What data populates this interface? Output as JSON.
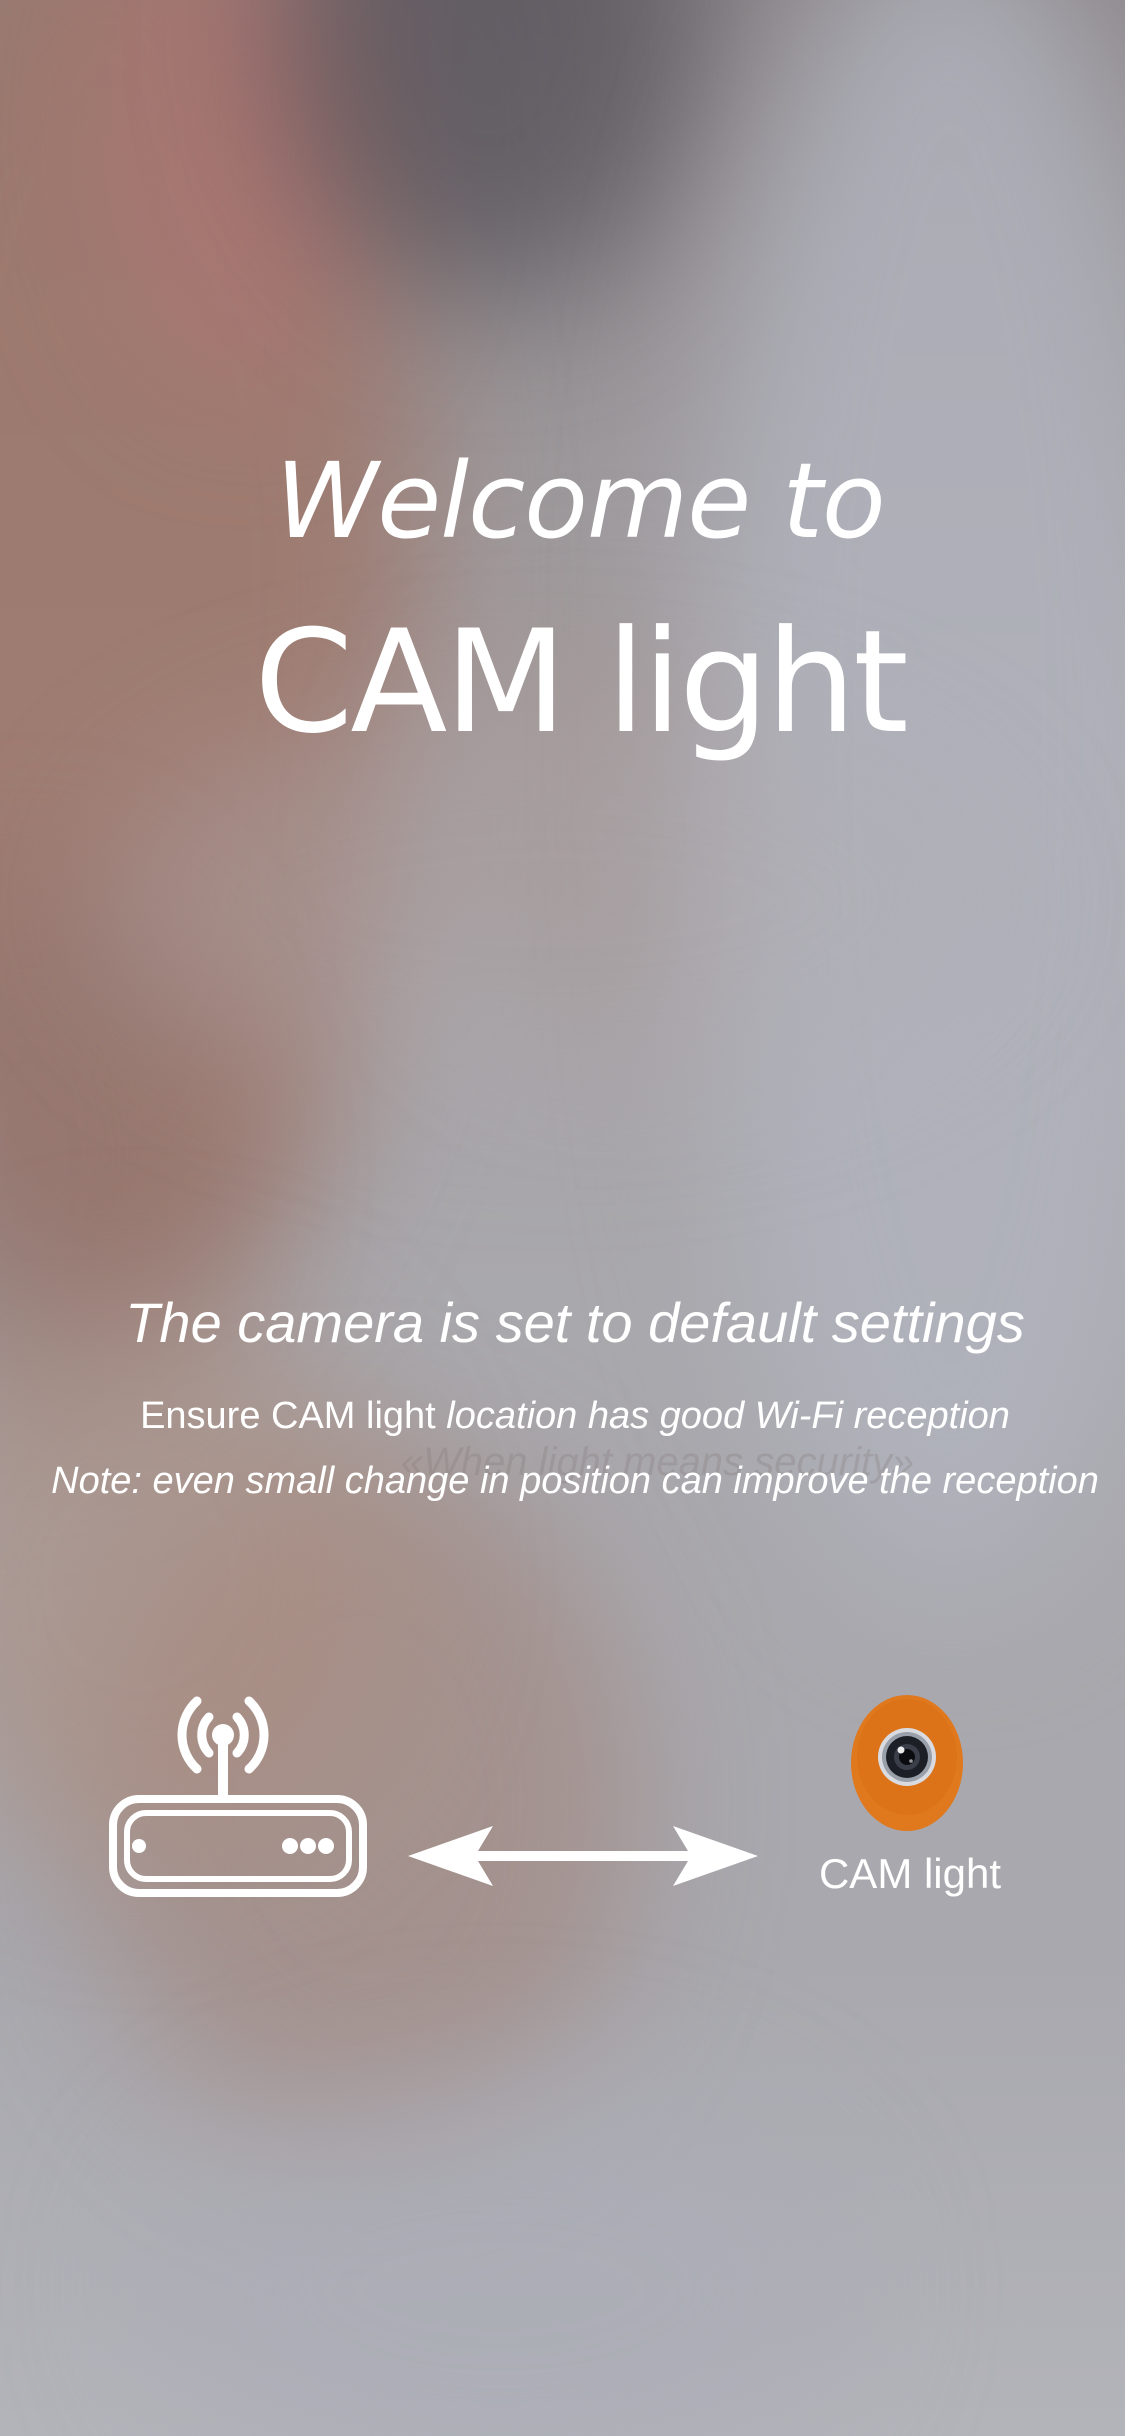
{
  "welcome": {
    "line1": "Welcome to",
    "line2": "CAM light"
  },
  "info": {
    "heading": "The camera is set to default settings",
    "line1_part1": "Ensure CAM light ",
    "line1_part2": "location has good Wi-Fi reception",
    "line2": "Note: even small change in position can improve the reception"
  },
  "watermark": {
    "text": "«When light means security»"
  },
  "diagram": {
    "router_icon": "wifi-router-icon",
    "arrow_icon": "double-arrow-icon",
    "camera_icon": "camera-icon",
    "camera_label": "CAM light"
  },
  "colors": {
    "text": "#ffffff",
    "camera_accent": "#e0781e"
  }
}
